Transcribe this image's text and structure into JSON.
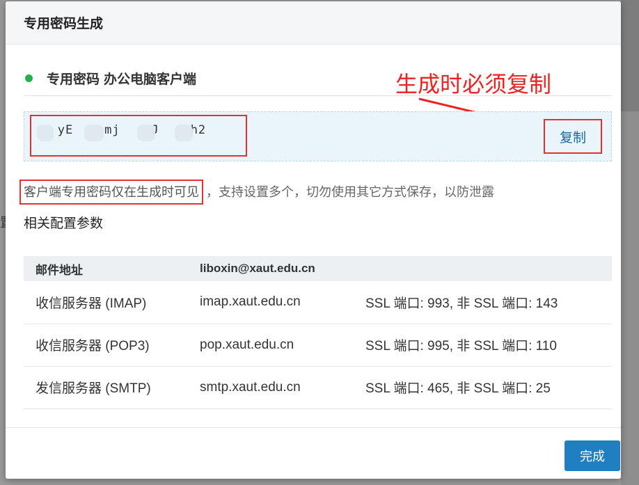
{
  "modal": {
    "title": "专用密码生成"
  },
  "section": {
    "title": "专用密码",
    "subtitle": "办公电脑客户端"
  },
  "annotation": {
    "text": "生成时必须复制"
  },
  "password": {
    "masked_value": "   yE    mj    J    h2",
    "copy_label": "复制"
  },
  "notice": {
    "highlight": "客户端专用密码仅在生成时可见",
    "rest": "，支持设置多个，切勿使用其它方式保存，以防泄露"
  },
  "config": {
    "title": "相关配置参数",
    "header": [
      "邮件地址",
      "liboxin@xaut.edu.cn",
      ""
    ],
    "rows": [
      [
        "收信服务器 (IMAP)",
        "imap.xaut.edu.cn",
        "SSL 端口: 993, 非 SSL 端口: 143"
      ],
      [
        "收信服务器 (POP3)",
        "pop.xaut.edu.cn",
        "SSL 端口: 995, 非 SSL 端口: 110"
      ],
      [
        "发信服务器 (SMTP)",
        "smtp.xaut.edu.cn",
        "SSL 端口: 465, 非 SSL 端口: 25"
      ]
    ]
  },
  "footer": {
    "done_label": "完成"
  },
  "colors": {
    "accent": "#1f7fc0",
    "status_dot": "#22b14c",
    "annotation_red": "#ee2222"
  }
}
